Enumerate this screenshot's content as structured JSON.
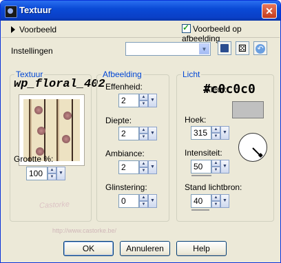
{
  "window": {
    "title": "Textuur",
    "close_glyph": "✕"
  },
  "top": {
    "preview_label": "Voorbeeld",
    "preview_checkbox_label": "Voorbeeld op afbeelding",
    "preview_checked": true
  },
  "settings": {
    "label": "Instellingen",
    "value": "",
    "dropdown_glyph": "▼"
  },
  "texture": {
    "legend": "Textuur",
    "name": "wp_floral_402",
    "size_label": "Grootte %:",
    "size_value": "100"
  },
  "image": {
    "legend": "Afbeelding",
    "relief_label": "Effenheid:",
    "relief_value": "2",
    "depth_label": "Diepte:",
    "depth_value": "2",
    "ambience_label": "Ambiance:",
    "ambience_value": "2",
    "gloss_label": "Glinstering:",
    "gloss_value": "0"
  },
  "light": {
    "legend": "Licht",
    "color_label": "Kleur:",
    "color_hex": "#c0c0c0",
    "angle_label": "Hoek:",
    "angle_value": "315",
    "intensity_label": "Intensiteit:",
    "intensity_value": "50",
    "elevation_label": "Stand lichtbron:",
    "elevation_value": "40"
  },
  "watermark": {
    "text": "Castorke",
    "url": "http://www.castorke.be/"
  },
  "buttons": {
    "ok": "OK",
    "cancel": "Annuleren",
    "help": "Help"
  },
  "icons": {
    "spin_up": "▲",
    "spin_down": "▼",
    "drop": "▼",
    "random": "⚄"
  }
}
